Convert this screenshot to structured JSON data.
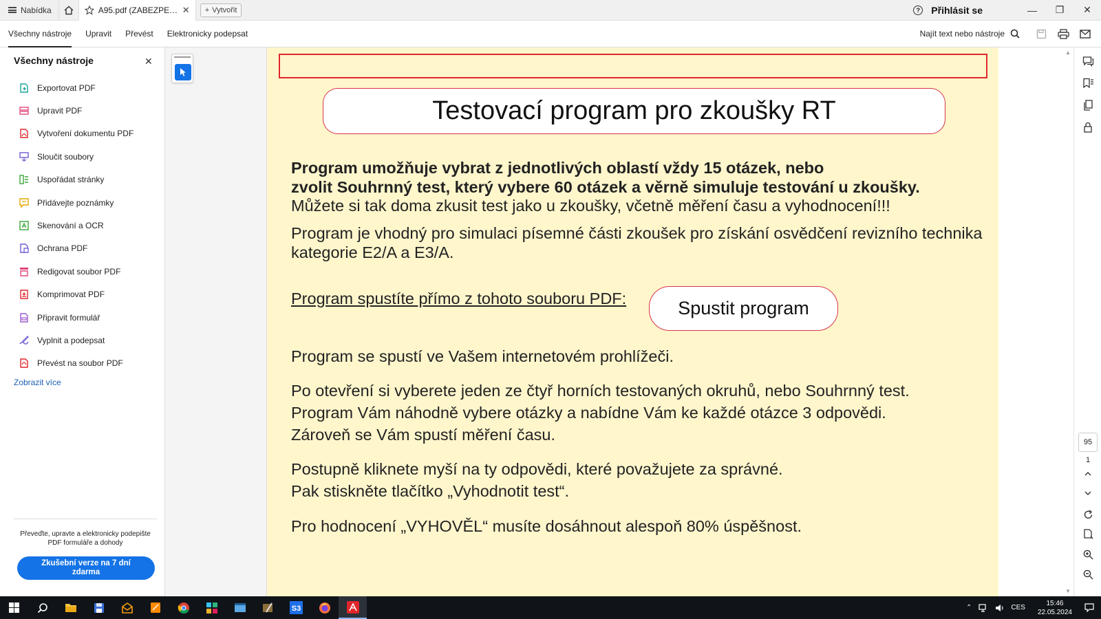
{
  "titlebar": {
    "menu_label": "Nabídka",
    "tab_title": "A95.pdf (ZABEZPEČ...",
    "create_label": "Vytvořit",
    "signin_label": "Přihlásit se"
  },
  "toolbar": {
    "tabs": [
      "Všechny nástroje",
      "Upravit",
      "Převést",
      "Elektronicky podepsat"
    ],
    "find_label": "Najít text nebo nástroje"
  },
  "left_panel": {
    "title": "Všechny nástroje",
    "items": [
      {
        "label": "Exportovat PDF",
        "icon": "export-pdf-icon",
        "color": "#1aa39a"
      },
      {
        "label": "Upravit PDF",
        "icon": "edit-pdf-icon",
        "color": "#e0467c"
      },
      {
        "label": "Vytvoření dokumentu PDF",
        "icon": "create-pdf-icon",
        "color": "#e0262b"
      },
      {
        "label": "Sloučit soubory",
        "icon": "combine-files-icon",
        "color": "#6d5dd3"
      },
      {
        "label": "Uspořádat stránky",
        "icon": "organize-pages-icon",
        "color": "#3aa53a"
      },
      {
        "label": "Přidávejte poznámky",
        "icon": "comment-icon",
        "color": "#e6a700"
      },
      {
        "label": "Skenování a OCR",
        "icon": "scan-ocr-icon",
        "color": "#3aa53a"
      },
      {
        "label": "Ochrana PDF",
        "icon": "protect-pdf-icon",
        "color": "#6d5dd3"
      },
      {
        "label": "Redigovat soubor PDF",
        "icon": "redact-icon",
        "color": "#e0467c"
      },
      {
        "label": "Komprimovat PDF",
        "icon": "compress-pdf-icon",
        "color": "#e0262b"
      },
      {
        "label": "Připravit formulář",
        "icon": "prepare-form-icon",
        "color": "#9b59d0"
      },
      {
        "label": "Vyplnit a podepsat",
        "icon": "fill-sign-icon",
        "color": "#6d5dd3"
      },
      {
        "label": "Převést na soubor PDF",
        "icon": "convert-pdf-icon",
        "color": "#e0262b"
      }
    ],
    "show_more": "Zobrazit více",
    "promo_text": "Převeďte, upravte a elektronicky podepište PDF formuláře a dohody",
    "trial_button": "Zkušební verze na 7 dní zdarma"
  },
  "document": {
    "title": "Testovací program pro zkoušky RT",
    "bold_line1": "Program umožňuje vybrat z jednotlivých oblastí vždy 15 otázek, nebo",
    "bold_line2": "zvolit Souhrnný test, který vybere 60 otázek a věrně simuluje testování u zkoušky.",
    "line3": "Můžete si tak doma zkusit test jako u zkoušky, včetně měření času a vyhodnocení!!!",
    "para2_line1": "Program je vhodný pro simulaci písemné části zkoušek pro získání osvědčení revizního technika",
    "para2_line2": "kategorie E2/A a E3/A.",
    "launch_text": "Program spustíte přímo z tohoto souboru PDF:",
    "run_button": "Spustit program",
    "para3": "Program se spustí ve Vašem internetovém prohlížeči.",
    "para4_line1": "Po otevření si vyberete jeden ze čtyř horních testovaných okruhů, nebo Souhrnný test.",
    "para4_line2": "Program Vám náhodně vybere otázky a nabídne Vám ke každé otázce 3 odpovědi.",
    "para4_line3": "Zároveň se Vám spustí měření času.",
    "para5_line1": "Postupně kliknete myší na ty odpovědi, které považujete za správné.",
    "para5_line2": "Pak stiskněte tlačítko „Vyhodnotit test“.",
    "para6": "Pro hodnocení „VYHOVĚL“ musíte dosáhnout alespoň 80% úspěšnost."
  },
  "page_nav": {
    "current": "95",
    "total": "1"
  },
  "taskbar": {
    "language": "CES",
    "time": "15:46",
    "date": "22.05.2024"
  },
  "colors": {
    "accent": "#1473e6",
    "page_bg": "#fff6cc",
    "border_red": "#d6344b"
  }
}
